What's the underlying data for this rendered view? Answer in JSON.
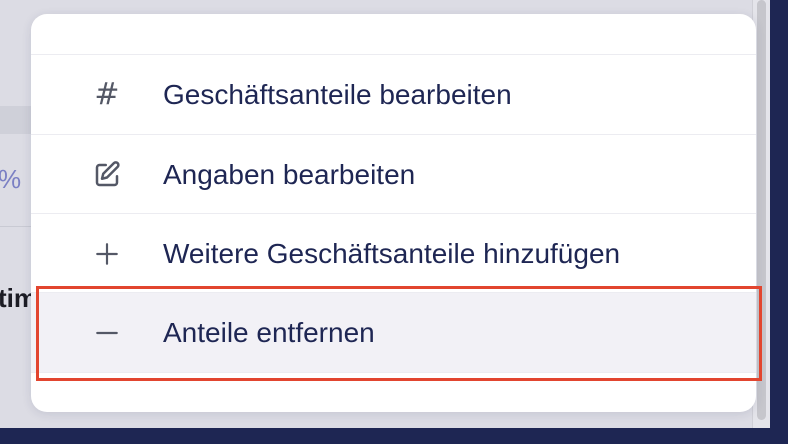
{
  "background": {
    "percent_fragment": "%",
    "bold_fragment": "tim"
  },
  "menu": {
    "items": [
      {
        "label": "Geschäftsanteile bearbeiten",
        "icon": "hash-icon"
      },
      {
        "label": "Angaben bearbeiten",
        "icon": "edit-icon"
      },
      {
        "label": "Weitere Geschäftsanteile hinzufügen",
        "icon": "plus-icon"
      },
      {
        "label": "Anteile entfernen",
        "icon": "minus-icon",
        "state": "hovered"
      }
    ]
  },
  "highlight_color": "#e2452f",
  "colors": {
    "label_text": "#1e2653",
    "icon": "#545866",
    "frame": "#1e2653",
    "hover_bg": "#f2f1f6"
  }
}
